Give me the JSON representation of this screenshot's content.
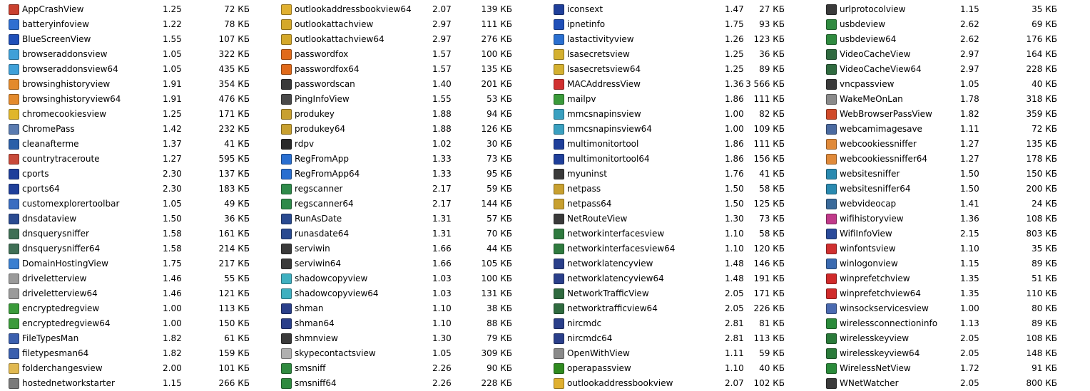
{
  "columns": [
    {
      "rows": [
        {
          "name": "AppCrashView",
          "version": "1.25",
          "size": "72 КБ",
          "color": "#c9402f"
        },
        {
          "name": "batteryinfoview",
          "version": "1.22",
          "size": "78 КБ",
          "color": "#2f6fd1"
        },
        {
          "name": "BlueScreenView",
          "version": "1.55",
          "size": "107 КБ",
          "color": "#1f4fb8"
        },
        {
          "name": "browseraddonsview",
          "version": "1.05",
          "size": "322 КБ",
          "color": "#3fa0d8"
        },
        {
          "name": "browseraddonsview64",
          "version": "1.05",
          "size": "435 КБ",
          "color": "#3fa0d8"
        },
        {
          "name": "browsinghistoryview",
          "version": "1.91",
          "size": "354 КБ",
          "color": "#e38a2c"
        },
        {
          "name": "browsinghistoryview64",
          "version": "1.91",
          "size": "476 КБ",
          "color": "#e38a2c"
        },
        {
          "name": "chromecookiesview",
          "version": "1.25",
          "size": "171 КБ",
          "color": "#e0b62a"
        },
        {
          "name": "ChromePass",
          "version": "1.42",
          "size": "232 КБ",
          "color": "#5a7bb0"
        },
        {
          "name": "cleanafterme",
          "version": "1.37",
          "size": "41 КБ",
          "color": "#2b5fa8"
        },
        {
          "name": "countrytraceroute",
          "version": "1.27",
          "size": "595 КБ",
          "color": "#c84a3a"
        },
        {
          "name": "cports",
          "version": "2.30",
          "size": "137 КБ",
          "color": "#1f3f9a"
        },
        {
          "name": "cports64",
          "version": "2.30",
          "size": "183 КБ",
          "color": "#1f3f9a"
        },
        {
          "name": "customexplorertoolbar",
          "version": "1.05",
          "size": "49 КБ",
          "color": "#3a6dc0"
        },
        {
          "name": "dnsdataview",
          "version": "1.50",
          "size": "36 КБ",
          "color": "#2a4a90"
        },
        {
          "name": "dnsquerysniffer",
          "version": "1.58",
          "size": "161 КБ",
          "color": "#3f6f55"
        },
        {
          "name": "dnsquerysniffer64",
          "version": "1.58",
          "size": "214 КБ",
          "color": "#3f6f55"
        },
        {
          "name": "DomainHostingView",
          "version": "1.75",
          "size": "217 КБ",
          "color": "#3a7fd0"
        },
        {
          "name": "driveletterview",
          "version": "1.46",
          "size": "55 КБ",
          "color": "#9a9a9a"
        },
        {
          "name": "driveletterview64",
          "version": "1.46",
          "size": "121 КБ",
          "color": "#9a9a9a"
        },
        {
          "name": "encryptedregview",
          "version": "1.00",
          "size": "113 КБ",
          "color": "#3a9a3a"
        },
        {
          "name": "encryptedregview64",
          "version": "1.00",
          "size": "150 КБ",
          "color": "#3a9a3a"
        },
        {
          "name": "FileTypesMan",
          "version": "1.82",
          "size": "61 КБ",
          "color": "#3b5fae"
        },
        {
          "name": "filetypesman64",
          "version": "1.82",
          "size": "159 КБ",
          "color": "#3b5fae"
        },
        {
          "name": "folderchangesview",
          "version": "2.00",
          "size": "101 КБ",
          "color": "#e0b850"
        },
        {
          "name": "hostednetworkstarter",
          "version": "1.15",
          "size": "266 КБ",
          "color": "#7a7a7a"
        }
      ]
    },
    {
      "rows": [
        {
          "name": "outlookaddressbookview64",
          "version": "2.07",
          "size": "139 КБ",
          "color": "#e0b030"
        },
        {
          "name": "outlookattachview",
          "version": "2.97",
          "size": "111 КБ",
          "color": "#d4a82a"
        },
        {
          "name": "outlookattachview64",
          "version": "2.97",
          "size": "276 КБ",
          "color": "#d4a82a"
        },
        {
          "name": "passwordfox",
          "version": "1.57",
          "size": "100 КБ",
          "color": "#e06a1a"
        },
        {
          "name": "passwordfox64",
          "version": "1.57",
          "size": "135 КБ",
          "color": "#e06a1a"
        },
        {
          "name": "passwordscan",
          "version": "1.40",
          "size": "201 КБ",
          "color": "#3a3a3a"
        },
        {
          "name": "PingInfoView",
          "version": "1.55",
          "size": "53 КБ",
          "color": "#4a4a4a"
        },
        {
          "name": "produkey",
          "version": "1.88",
          "size": "94 КБ",
          "color": "#c8a030"
        },
        {
          "name": "produkey64",
          "version": "1.88",
          "size": "126 КБ",
          "color": "#c8a030"
        },
        {
          "name": "rdpv",
          "version": "1.02",
          "size": "30 КБ",
          "color": "#2a2a2a"
        },
        {
          "name": "RegFromApp",
          "version": "1.33",
          "size": "73 КБ",
          "color": "#2a6fd0"
        },
        {
          "name": "RegFromApp64",
          "version": "1.33",
          "size": "95 КБ",
          "color": "#2a6fd0"
        },
        {
          "name": "regscanner",
          "version": "2.17",
          "size": "59 КБ",
          "color": "#2f8a4a"
        },
        {
          "name": "regscanner64",
          "version": "2.17",
          "size": "144 КБ",
          "color": "#2f8a4a"
        },
        {
          "name": "RunAsDate",
          "version": "1.31",
          "size": "57 КБ",
          "color": "#2a4a90"
        },
        {
          "name": "runasdate64",
          "version": "1.31",
          "size": "70 КБ",
          "color": "#2a4a90"
        },
        {
          "name": "serviwin",
          "version": "1.66",
          "size": "44 КБ",
          "color": "#3a3a3a"
        },
        {
          "name": "serviwin64",
          "version": "1.66",
          "size": "105 КБ",
          "color": "#3a3a3a"
        },
        {
          "name": "shadowcopyview",
          "version": "1.03",
          "size": "100 КБ",
          "color": "#3fb0c0"
        },
        {
          "name": "shadowcopyview64",
          "version": "1.03",
          "size": "131 КБ",
          "color": "#3fb0c0"
        },
        {
          "name": "shman",
          "version": "1.10",
          "size": "38 КБ",
          "color": "#2a3f8a"
        },
        {
          "name": "shman64",
          "version": "1.10",
          "size": "88 КБ",
          "color": "#2a3f8a"
        },
        {
          "name": "shmnview",
          "version": "1.30",
          "size": "79 КБ",
          "color": "#3a3a3a"
        },
        {
          "name": "skypecontactsview",
          "version": "1.05",
          "size": "309 КБ",
          "color": "#b0b0b0"
        },
        {
          "name": "smsniff",
          "version": "2.26",
          "size": "90 КБ",
          "color": "#2f8a3f"
        },
        {
          "name": "smsniff64",
          "version": "2.26",
          "size": "228 КБ",
          "color": "#2f8a3f"
        }
      ]
    },
    {
      "rows": [
        {
          "name": "iconsext",
          "version": "1.47",
          "size": "27 КБ",
          "color": "#1f3f9a"
        },
        {
          "name": "ipnetinfo",
          "version": "1.75",
          "size": "93 КБ",
          "color": "#1f4fb8"
        },
        {
          "name": "lastactivityview",
          "version": "1.26",
          "size": "123 КБ",
          "color": "#2a6fd0"
        },
        {
          "name": "lsasecretsview",
          "version": "1.25",
          "size": "36 КБ",
          "color": "#d4b030"
        },
        {
          "name": "lsasecretsview64",
          "version": "1.25",
          "size": "89 КБ",
          "color": "#d4b030"
        },
        {
          "name": "MACAddressView",
          "version": "1.36",
          "size": "3 566 КБ",
          "color": "#d03030"
        },
        {
          "name": "mailpv",
          "version": "1.86",
          "size": "111 КБ",
          "color": "#3a9a3a"
        },
        {
          "name": "mmcsnapinsview",
          "version": "1.00",
          "size": "82 КБ",
          "color": "#3aa0c0"
        },
        {
          "name": "mmcsnapinsview64",
          "version": "1.00",
          "size": "109 КБ",
          "color": "#3aa0c0"
        },
        {
          "name": "multimonitortool",
          "version": "1.86",
          "size": "111 КБ",
          "color": "#1f3f9a"
        },
        {
          "name": "multimonitortool64",
          "version": "1.86",
          "size": "156 КБ",
          "color": "#1f3f9a"
        },
        {
          "name": "myuninst",
          "version": "1.76",
          "size": "41 КБ",
          "color": "#3a3a3a"
        },
        {
          "name": "netpass",
          "version": "1.50",
          "size": "58 КБ",
          "color": "#c8a030"
        },
        {
          "name": "netpass64",
          "version": "1.50",
          "size": "125 КБ",
          "color": "#c8a030"
        },
        {
          "name": "NetRouteView",
          "version": "1.30",
          "size": "73 КБ",
          "color": "#3a3a3a"
        },
        {
          "name": "networkinterfacesview",
          "version": "1.10",
          "size": "58 КБ",
          "color": "#2f7a3f"
        },
        {
          "name": "networkinterfacesview64",
          "version": "1.10",
          "size": "120 КБ",
          "color": "#2f7a3f"
        },
        {
          "name": "networklatencyview",
          "version": "1.48",
          "size": "146 КБ",
          "color": "#2a3f8a"
        },
        {
          "name": "networklatencyview64",
          "version": "1.48",
          "size": "191 КБ",
          "color": "#2a3f8a"
        },
        {
          "name": "NetworkTrafficView",
          "version": "2.05",
          "size": "171 КБ",
          "color": "#2f6a3f"
        },
        {
          "name": "networktrafficview64",
          "version": "2.05",
          "size": "226 КБ",
          "color": "#2f6a3f"
        },
        {
          "name": "nircmdc",
          "version": "2.81",
          "size": "81 КБ",
          "color": "#2a3f8a"
        },
        {
          "name": "nircmdc64",
          "version": "2.81",
          "size": "113 КБ",
          "color": "#2a3f8a"
        },
        {
          "name": "OpenWithView",
          "version": "1.11",
          "size": "59 КБ",
          "color": "#8a8a8a"
        },
        {
          "name": "operapassview",
          "version": "1.10",
          "size": "40 КБ",
          "color": "#2f8a1f"
        },
        {
          "name": "outlookaddressbookview",
          "version": "2.07",
          "size": "102 КБ",
          "color": "#e0b030"
        }
      ]
    },
    {
      "rows": [
        {
          "name": "urlprotocolview",
          "version": "1.15",
          "size": "35 КБ",
          "color": "#3a3a3a"
        },
        {
          "name": "usbdeview",
          "version": "2.62",
          "size": "69 КБ",
          "color": "#2f8a3f"
        },
        {
          "name": "usbdeview64",
          "version": "2.62",
          "size": "176 КБ",
          "color": "#2f8a3f"
        },
        {
          "name": "VideoCacheView",
          "version": "2.97",
          "size": "164 КБ",
          "color": "#2f6a3f"
        },
        {
          "name": "VideoCacheView64",
          "version": "2.97",
          "size": "228 КБ",
          "color": "#2f6a3f"
        },
        {
          "name": "vncpassview",
          "version": "1.05",
          "size": "40 КБ",
          "color": "#3a3a3a"
        },
        {
          "name": "WakeMeOnLan",
          "version": "1.78",
          "size": "318 КБ",
          "color": "#8a8a8a"
        },
        {
          "name": "WebBrowserPassView",
          "version": "1.82",
          "size": "359 КБ",
          "color": "#d04a2a"
        },
        {
          "name": "webcamimagesave",
          "version": "1.11",
          "size": "72 КБ",
          "color": "#4a6aa0"
        },
        {
          "name": "webcookiessniffer",
          "version": "1.27",
          "size": "135 КБ",
          "color": "#e08a3a"
        },
        {
          "name": "webcookiessniffer64",
          "version": "1.27",
          "size": "178 КБ",
          "color": "#e08a3a"
        },
        {
          "name": "websitesniffer",
          "version": "1.50",
          "size": "150 КБ",
          "color": "#2a8ab0"
        },
        {
          "name": "websitesniffer64",
          "version": "1.50",
          "size": "200 КБ",
          "color": "#2a8ab0"
        },
        {
          "name": "webvideocap",
          "version": "1.41",
          "size": "24 КБ",
          "color": "#3a6a9a"
        },
        {
          "name": "wifihistoryview",
          "version": "1.36",
          "size": "108 КБ",
          "color": "#c03a8a"
        },
        {
          "name": "WifiInfoView",
          "version": "2.15",
          "size": "803 КБ",
          "color": "#2a4a9a"
        },
        {
          "name": "winfontsview",
          "version": "1.10",
          "size": "35 КБ",
          "color": "#d03030"
        },
        {
          "name": "winlogonview",
          "version": "1.15",
          "size": "89 КБ",
          "color": "#3a6ab0"
        },
        {
          "name": "winprefetchview",
          "version": "1.35",
          "size": "51 КБ",
          "color": "#d02a2a"
        },
        {
          "name": "winprefetchview64",
          "version": "1.35",
          "size": "110 КБ",
          "color": "#d02a2a"
        },
        {
          "name": "winsockservicesview",
          "version": "1.00",
          "size": "80 КБ",
          "color": "#4a6ab0"
        },
        {
          "name": "wirelessconnectioninfo",
          "version": "1.13",
          "size": "89 КБ",
          "color": "#2a8a3a"
        },
        {
          "name": "wirelesskeyview",
          "version": "2.05",
          "size": "108 КБ",
          "color": "#2a7a3a"
        },
        {
          "name": "wirelesskeyview64",
          "version": "2.05",
          "size": "148 КБ",
          "color": "#2a7a3a"
        },
        {
          "name": "WirelessNetView",
          "version": "1.72",
          "size": "91 КБ",
          "color": "#2a8a3a"
        },
        {
          "name": "WNetWatcher",
          "version": "2.05",
          "size": "800 КБ",
          "color": "#3a3a3a"
        }
      ]
    }
  ]
}
